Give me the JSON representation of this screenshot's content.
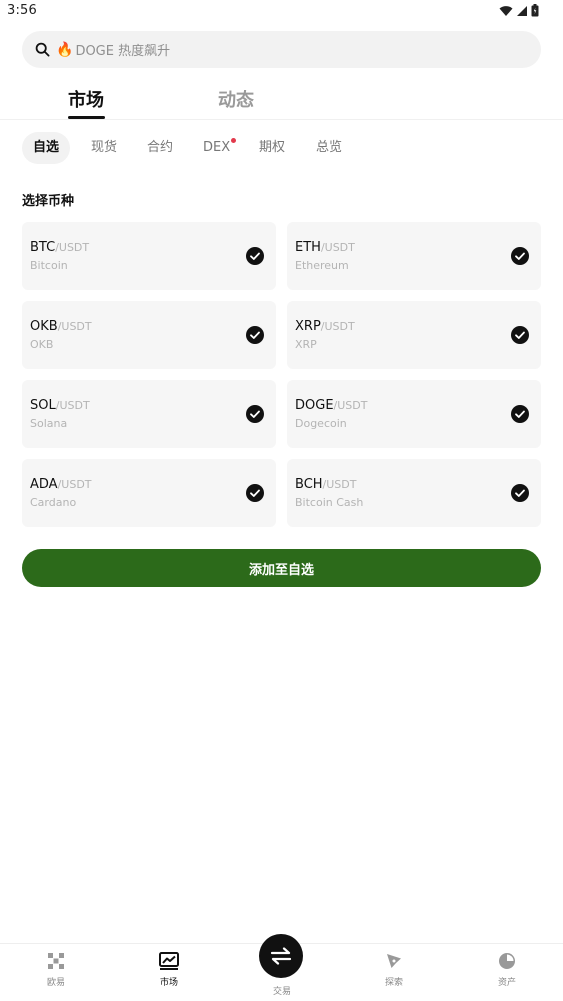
{
  "status": {
    "time": "3:56"
  },
  "search": {
    "fire": "🔥",
    "text": "DOGE 热度飙升"
  },
  "main_tabs": [
    {
      "label": "市场"
    },
    {
      "label": "动态"
    }
  ],
  "sub_tabs": [
    {
      "label": "自选"
    },
    {
      "label": "现货"
    },
    {
      "label": "合约"
    },
    {
      "label": "DEX"
    },
    {
      "label": "期权"
    },
    {
      "label": "总览"
    }
  ],
  "section_title": "选择币种",
  "coins": [
    {
      "base": "BTC",
      "quote": "/USDT",
      "name": "Bitcoin"
    },
    {
      "base": "ETH",
      "quote": "/USDT",
      "name": "Ethereum"
    },
    {
      "base": "OKB",
      "quote": "/USDT",
      "name": "OKB"
    },
    {
      "base": "XRP",
      "quote": "/USDT",
      "name": "XRP"
    },
    {
      "base": "SOL",
      "quote": "/USDT",
      "name": "Solana"
    },
    {
      "base": "DOGE",
      "quote": "/USDT",
      "name": "Dogecoin"
    },
    {
      "base": "ADA",
      "quote": "/USDT",
      "name": "Cardano"
    },
    {
      "base": "BCH",
      "quote": "/USDT",
      "name": "Bitcoin Cash"
    }
  ],
  "add_button": "添加至自选",
  "bottom_nav": [
    {
      "label": "欧易",
      "icon": "okx-logo-icon"
    },
    {
      "label": "市场",
      "icon": "market-chart-icon"
    },
    {
      "label": "交易",
      "icon": "swap-arrows-icon"
    },
    {
      "label": "探索",
      "icon": "compass-icon"
    },
    {
      "label": "资产",
      "icon": "pie-chart-icon"
    }
  ],
  "colors": {
    "accent": "#2c6a1a",
    "dot": "#e23a4c"
  }
}
